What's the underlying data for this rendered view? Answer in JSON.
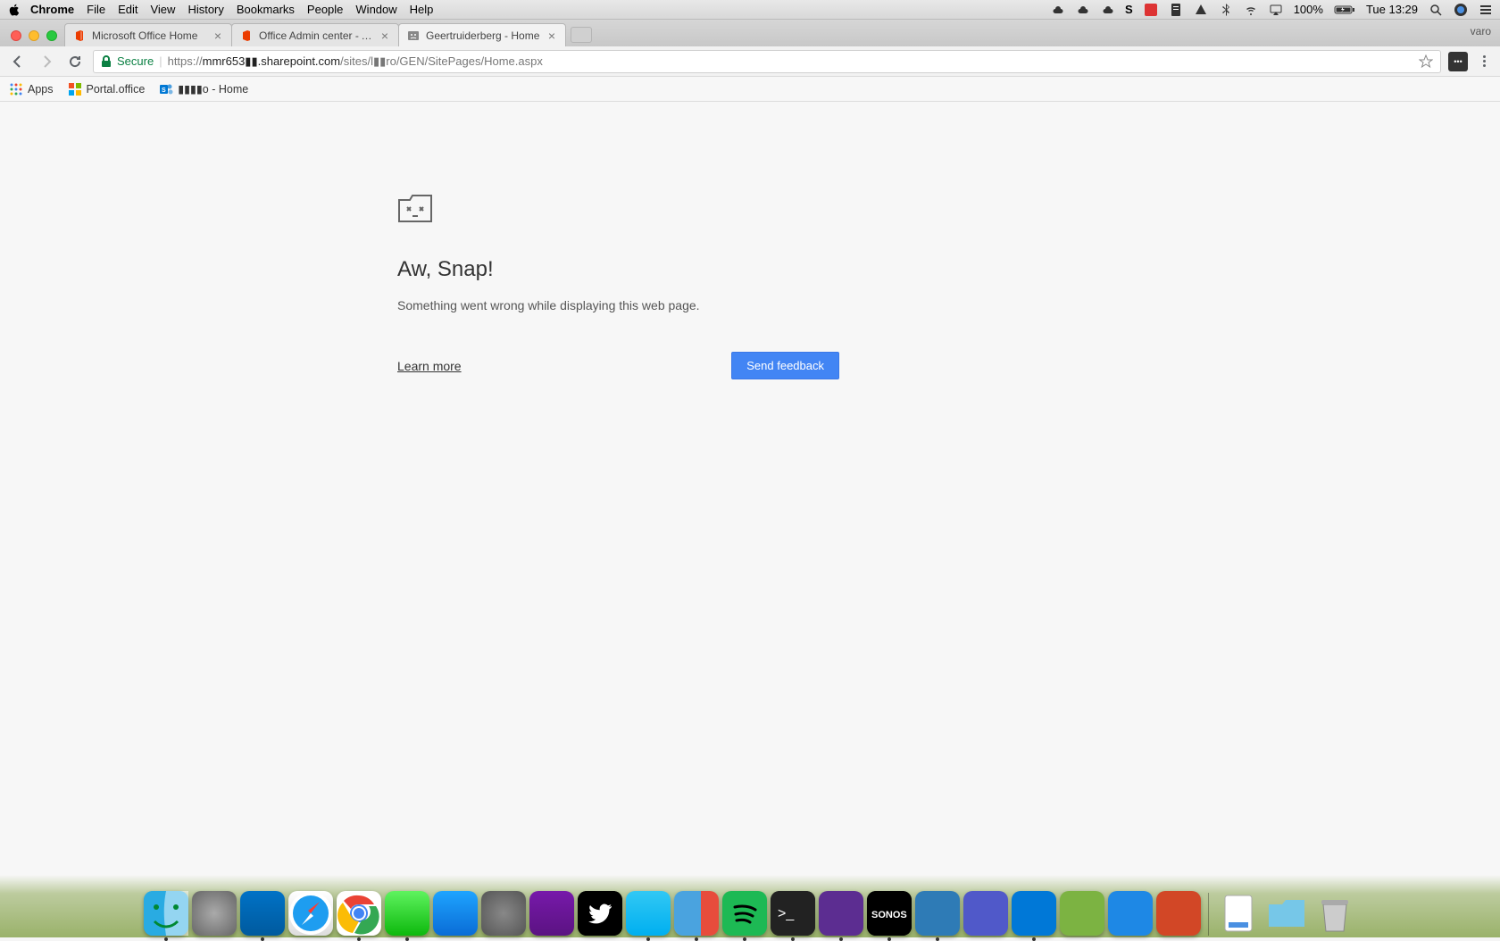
{
  "menubar": {
    "app": "Chrome",
    "items": [
      "File",
      "Edit",
      "View",
      "History",
      "Bookmarks",
      "People",
      "Window",
      "Help"
    ],
    "battery": "100%",
    "clock": "Tue 13:29"
  },
  "tabs": [
    {
      "title": "Microsoft Office Home",
      "active": false
    },
    {
      "title": "Office Admin center - Active u",
      "active": false
    },
    {
      "title": "Geertruiderberg - Home",
      "active": true
    }
  ],
  "profile": "varo",
  "omnibox": {
    "secure": "Secure",
    "url_prefix": "https://",
    "url_host": "mmr653▮▮.sharepoint.com",
    "url_path": "/sites/l▮▮ro/GEN/SitePages/Home.aspx"
  },
  "bookmarks": [
    {
      "label": "Apps"
    },
    {
      "label": "Portal.office"
    },
    {
      "label": "▮▮▮▮o - Home"
    }
  ],
  "error": {
    "title": "Aw, Snap!",
    "message": "Something went wrong while displaying this web page.",
    "learn_more": "Learn more",
    "send_feedback": "Send feedback"
  },
  "dock": [
    {
      "name": "finder",
      "bg": "linear-gradient(#29abe2,#1b75bb)",
      "running": true
    },
    {
      "name": "launchpad",
      "bg": "radial-gradient(#aaa,#666)",
      "running": false
    },
    {
      "name": "outlook",
      "bg": "linear-gradient(#0072c6,#005a9e)",
      "running": true
    },
    {
      "name": "safari",
      "bg": "linear-gradient(#fff,#ddd)",
      "running": false
    },
    {
      "name": "chrome",
      "bg": "#fff",
      "running": true
    },
    {
      "name": "messages",
      "bg": "linear-gradient(#5ff35f,#0db80d)",
      "running": true
    },
    {
      "name": "appstore",
      "bg": "linear-gradient(#1ea4ff,#0a6cd6)",
      "running": false
    },
    {
      "name": "settings",
      "bg": "radial-gradient(#888,#555)",
      "running": false
    },
    {
      "name": "onenote",
      "bg": "linear-gradient(#7719aa,#5b1382)",
      "running": false
    },
    {
      "name": "twitter",
      "bg": "#000",
      "running": false
    },
    {
      "name": "skype",
      "bg": "linear-gradient(#32c8f4,#00aff0)",
      "running": true
    },
    {
      "name": "parallels",
      "bg": "linear-gradient(90deg,#4aa3df 60%,#e74c3c 60%)",
      "running": true
    },
    {
      "name": "spotify",
      "bg": "#1db954",
      "running": true
    },
    {
      "name": "terminal",
      "bg": "#222",
      "running": true
    },
    {
      "name": "visualstudio",
      "bg": "#5c2d91",
      "running": true
    },
    {
      "name": "sonos",
      "bg": "#000",
      "running": true
    },
    {
      "name": "snagit",
      "bg": "#2e7bb6",
      "running": true
    },
    {
      "name": "teams",
      "bg": "#5059c9",
      "running": false
    },
    {
      "name": "vscode",
      "bg": "#0078d7",
      "running": true
    },
    {
      "name": "camtasia",
      "bg": "#7cb342",
      "running": false
    },
    {
      "name": "app-blue",
      "bg": "#1e88e5",
      "running": false
    },
    {
      "name": "powerpoint",
      "bg": "#d24726",
      "running": false
    }
  ]
}
